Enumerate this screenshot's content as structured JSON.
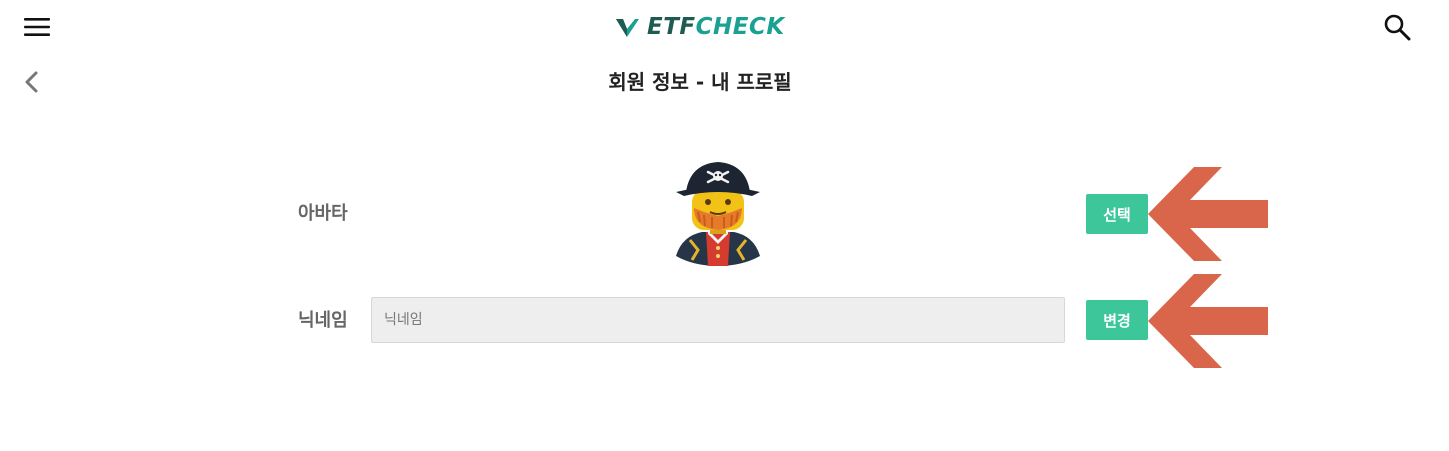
{
  "header": {
    "logo_part1": "ETF",
    "logo_part2": "CHECK",
    "menu_icon": "hamburger-icon",
    "search_icon": "search-icon"
  },
  "page": {
    "back_icon": "chevron-left-icon",
    "title": "회원 정보 - 내 프로필"
  },
  "profile": {
    "avatar_label": "아바타",
    "avatar_image": "pirate-avatar",
    "select_button": "선택",
    "nickname_label": "닉네임",
    "nickname_placeholder": "닉네임",
    "nickname_value": "",
    "change_button": "변경"
  },
  "annotations": {
    "arrow_color": "#d9664a",
    "arrow_icon": "arrow-left-icon"
  },
  "colors": {
    "accent_button": "#3cc69a",
    "logo_dark": "#1f5b52",
    "logo_light": "#1aa191"
  }
}
